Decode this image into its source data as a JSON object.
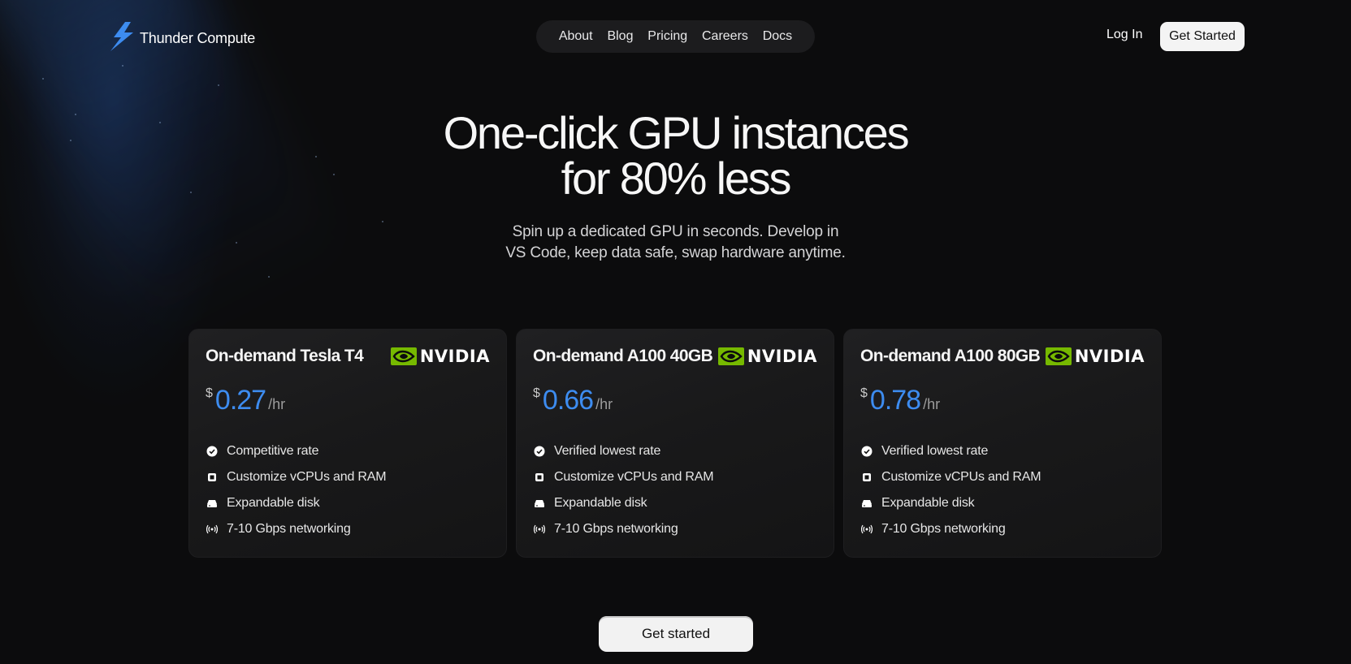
{
  "brand": {
    "name": "Thunder Compute",
    "icon": "lightning-bolt-icon",
    "accent": "#3d8cf0"
  },
  "nav": {
    "links": [
      "About",
      "Blog",
      "Pricing",
      "Careers",
      "Docs"
    ],
    "login": "Log In",
    "cta": "Get Started"
  },
  "hero": {
    "title_line1": "One-click GPU instances",
    "title_line2": "for 80% less",
    "subtitle_line1": "Spin up a dedicated GPU in seconds. Develop in",
    "subtitle_line2": "VS Code, keep data safe, swap hardware anytime."
  },
  "cards": [
    {
      "title": "On-demand Tesla T4",
      "vendor": "NVIDIA",
      "currency": "$",
      "price": "0.27",
      "unit": "/hr",
      "features": [
        {
          "icon": "check-circle-icon",
          "text": "Competitive rate"
        },
        {
          "icon": "chip-icon",
          "text": "Customize vCPUs and RAM"
        },
        {
          "icon": "disk-icon",
          "text": "Expandable disk"
        },
        {
          "icon": "signal-icon",
          "text": "7-10 Gbps networking"
        }
      ]
    },
    {
      "title": "On-demand A100 40GB",
      "vendor": "NVIDIA",
      "currency": "$",
      "price": "0.66",
      "unit": "/hr",
      "features": [
        {
          "icon": "check-circle-icon",
          "text": "Verified lowest rate"
        },
        {
          "icon": "chip-icon",
          "text": "Customize vCPUs and RAM"
        },
        {
          "icon": "disk-icon",
          "text": "Expandable disk"
        },
        {
          "icon": "signal-icon",
          "text": "7-10 Gbps networking"
        }
      ]
    },
    {
      "title": "On-demand A100 80GB",
      "vendor": "NVIDIA",
      "currency": "$",
      "price": "0.78",
      "unit": "/hr",
      "features": [
        {
          "icon": "check-circle-icon",
          "text": "Verified lowest rate"
        },
        {
          "icon": "chip-icon",
          "text": "Customize vCPUs and RAM"
        },
        {
          "icon": "disk-icon",
          "text": "Expandable disk"
        },
        {
          "icon": "signal-icon",
          "text": "7-10 Gbps networking"
        }
      ]
    }
  ],
  "main_cta": "Get started"
}
